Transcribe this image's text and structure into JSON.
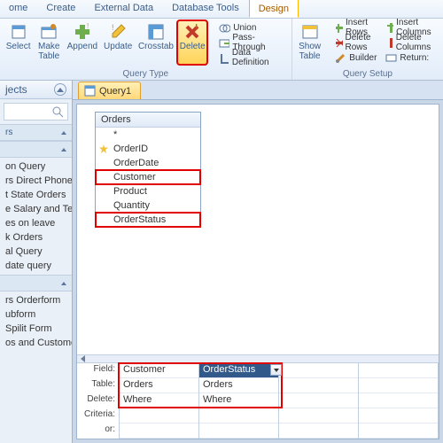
{
  "tabs": [
    "ome",
    "Create",
    "External Data",
    "Database Tools",
    "Design"
  ],
  "active_tab": 4,
  "ribbon": {
    "query_type": {
      "title": "Query Type",
      "buttons": {
        "select": "Select",
        "make_table": "Make\nTable",
        "append": "Append",
        "update": "Update",
        "crosstab": "Crosstab",
        "delete": "Delete",
        "union": "Union",
        "pass_through": "Pass-Through",
        "data_definition": "Data Definition"
      }
    },
    "query_setup": {
      "title": "Query Setup",
      "buttons": {
        "show_table": "Show\nTable",
        "insert_rows": "Insert Rows",
        "delete_rows": "Delete Rows",
        "builder": "Builder",
        "insert_columns": "Insert Columns",
        "delete_columns": "Delete Columns",
        "return": "Return:"
      }
    }
  },
  "nav": {
    "title": "jects",
    "sections": [
      {
        "title": "rs",
        "items": []
      },
      {
        "title": "",
        "items": [
          "on Query",
          "rs Direct Phone Query",
          "t State Orders",
          "e Salary and Tenure Q...",
          "es on leave",
          "k Orders",
          "al Query",
          "date query"
        ]
      },
      {
        "title": "",
        "items": [
          "rs Orderform",
          "ubform",
          "Spilit Form",
          "os and Customer form"
        ]
      }
    ]
  },
  "query_tab": "Query1",
  "table": {
    "name": "Orders",
    "fields": [
      "*",
      "OrderID",
      "OrderDate",
      "Customer",
      "Product",
      "Quantity",
      "OrderStatus"
    ],
    "key_index": 1,
    "highlight": [
      3,
      6
    ]
  },
  "qbe": {
    "labels": [
      "Field:",
      "Table:",
      "Delete:",
      "Criteria:",
      "or:"
    ],
    "cols": [
      {
        "field": "Customer",
        "table": "Orders",
        "delete": "Where",
        "criteria": "",
        "or": ""
      },
      {
        "field": "OrderStatus",
        "table": "Orders",
        "delete": "Where",
        "criteria": "",
        "or": ""
      },
      {
        "field": "",
        "table": "",
        "delete": "",
        "criteria": "",
        "or": ""
      },
      {
        "field": "",
        "table": "",
        "delete": "",
        "criteria": "",
        "or": ""
      }
    ],
    "selected_col": 1
  }
}
